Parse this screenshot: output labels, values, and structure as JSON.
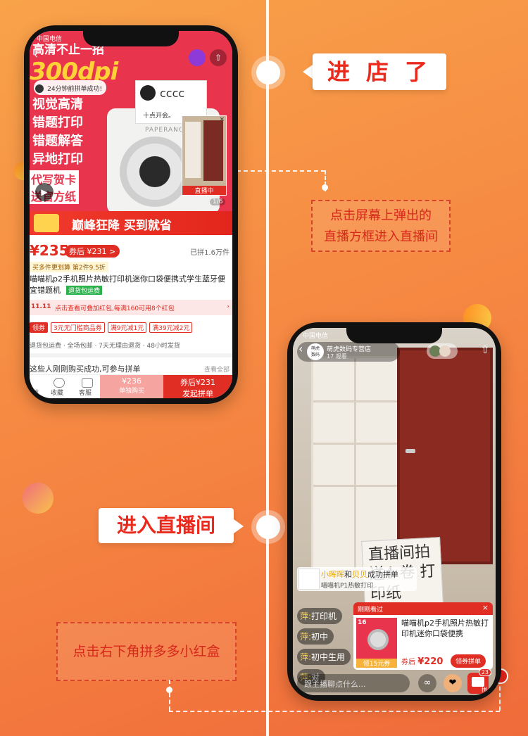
{
  "steps": {
    "step1_title": "进 店 了",
    "step1_note_line1": "点击屏幕上弹出的",
    "step1_note_line2": "直播方框进入直播间",
    "step2_title": "进入直播间",
    "step2_note": "点击右下角拼多多小红盒"
  },
  "phone1": {
    "status_carrier": "中国电信",
    "top_banner": "高清不止一招",
    "dpi_badge": "300dpi",
    "recent_group_toast": "24分钟前拼单成功!",
    "features": [
      "视觉高清",
      "错题打印",
      "错题解答",
      "异地打印"
    ],
    "cards_line1": "代写贺卡",
    "cards_line2": "送官方纸",
    "paper_note": "十点开会。",
    "printer_brand": "PAPERANG",
    "live_mini_label": "直播中",
    "gallery_index": "1/6",
    "promo_banner": "巅峰狂降  买到就省",
    "price": "¥235",
    "after_coupon_badge": "券后 ¥231 >",
    "sold_count": "已拼1.6万件",
    "multi_buy": "买多件更划算 第2件9.5折",
    "product_title_line1": "喵喵机p2手机照片热敏打印机迷你口袋便携式学生蓝牙便",
    "product_title_line2": "宜错题机",
    "return_tag": "退货包运费",
    "red_packet_bar": "点击查看可叠加红包,每满160可用8个红包",
    "coupons": [
      "3元无门槛商品券",
      "满9元减1元",
      "满39元减2元"
    ],
    "services": "退货包运费 · 全场包邮 · 7天无理由退货 · 48小时发货",
    "recent_buyers": "这些人刚刚购买成功,可参与拼单",
    "more_link": "查看全部",
    "nav_store": "首",
    "nav_fav": "收藏",
    "nav_service": "客服",
    "btn_single_price": "¥236",
    "btn_single_label": "单独购买",
    "btn_group_price": "券后¥231",
    "btn_group_label": "发起拼单"
  },
  "phone2": {
    "status_carrier": "中国电信",
    "shop_name": "萌虎数码专营店",
    "viewers": "17 观看",
    "shop_badge_line1": "萌虎",
    "shop_badge_line2": "数码",
    "handwritten": "直播间拍 送4 卷 打印纸",
    "group_notice_name1": "小晖晖",
    "group_notice_and": "和",
    "group_notice_name2": "贝贝",
    "group_notice_action": "成功拼单",
    "group_notice_item": "喵喵机P1热敏打印",
    "chats": [
      {
        "user": "萍:",
        "text": "打印机"
      },
      {
        "user": "萍:",
        "text": "初中"
      },
      {
        "user": "萍:",
        "text": "初中生用"
      },
      {
        "user": "萍:",
        "text": "对"
      }
    ],
    "popup_header": "刚刚看过",
    "popup_title": "喵喵机p2手机照片热敏打印机迷你口袋便携",
    "popup_coupon": "领15元券",
    "popup_price_label": "券后",
    "popup_price": "¥220",
    "popup_button": "领券拼单",
    "popup_index": "16",
    "input_placeholder": "跟主播聊点什么...",
    "redbox_count": "23",
    "redbox_label": "拼"
  },
  "colors": {
    "accent_red": "#e02e24",
    "bg_orange": "#f68a43"
  }
}
